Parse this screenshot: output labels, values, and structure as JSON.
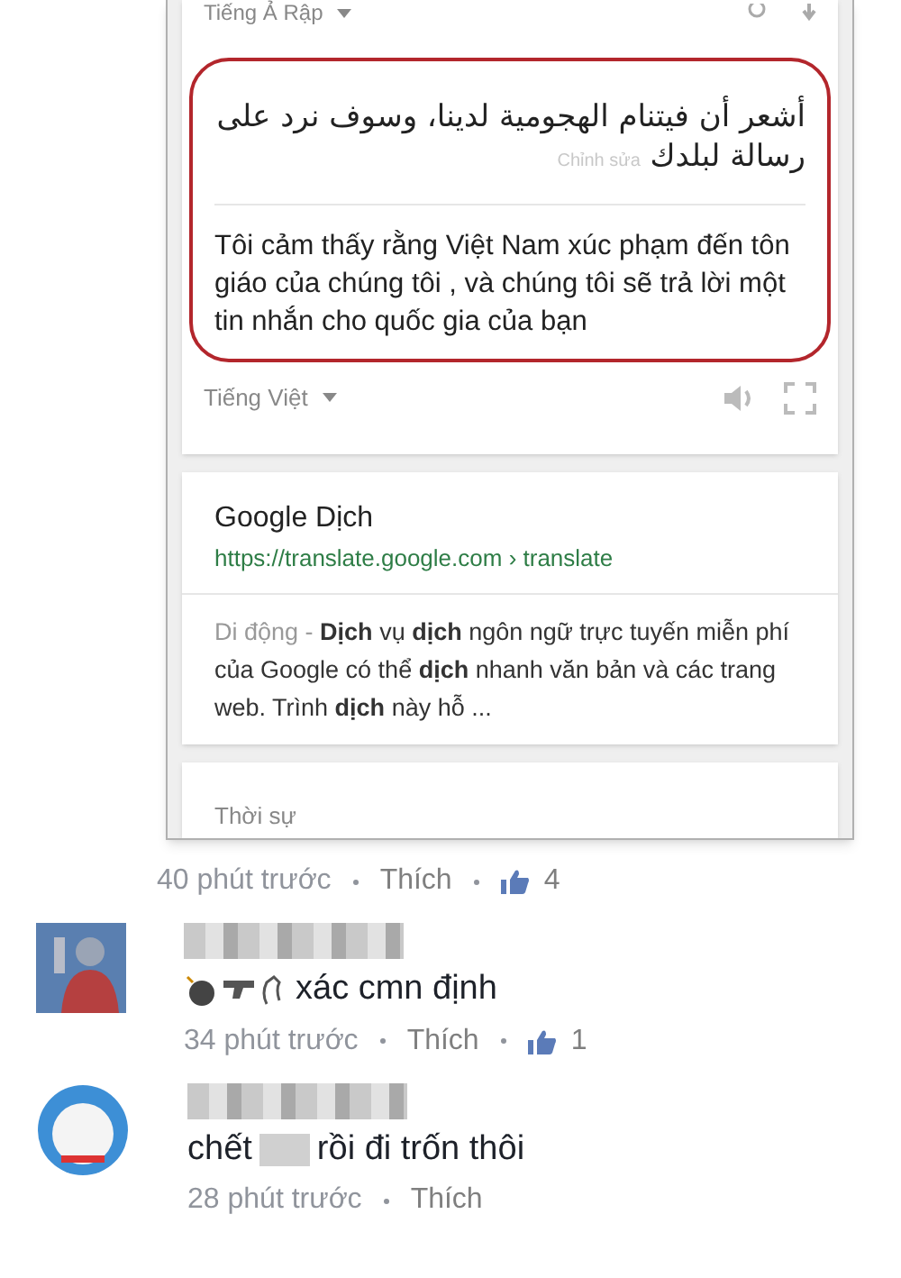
{
  "embedded_screenshot": {
    "source_language": "Tiếng Ả Rập",
    "source_text": "أشعر أن فيتنام الهجومية لدينا، وسوف نرد على رسالة لبلدك",
    "edit_link": "Chỉnh sửa",
    "translation": "Tôi cảm thấy rằng Việt Nam xúc phạm đến tôn giáo của chúng tôi , và chúng tôi sẽ trả lời một tin nhắn cho quốc gia của bạn",
    "target_language": "Tiếng Việt",
    "result": {
      "title": "Google Dịch",
      "url": "https://translate.google.com › translate",
      "snippet_prefix": "Di động -",
      "snippet": "**Dịch** vụ **dịch** ngôn ngữ trực tuyến miễn phí của Google có thể **dịch** nhanh văn bản và các trang web. Trình **dịch** này hỗ ..."
    },
    "next_card": "Thời sự"
  },
  "post_meta": {
    "time": "40 phút trước",
    "like": "Thích",
    "like_count": "4"
  },
  "comments": [
    {
      "kind": "emoji",
      "text": [
        "xác cmn định"
      ],
      "time": "34 phút trước",
      "like": "Thích",
      "like_count": "1"
    },
    {
      "kind": "censored",
      "text": [
        "chết",
        "rồi đi trốn thôi"
      ],
      "time": "28 phút trước",
      "like": "Thích"
    }
  ]
}
